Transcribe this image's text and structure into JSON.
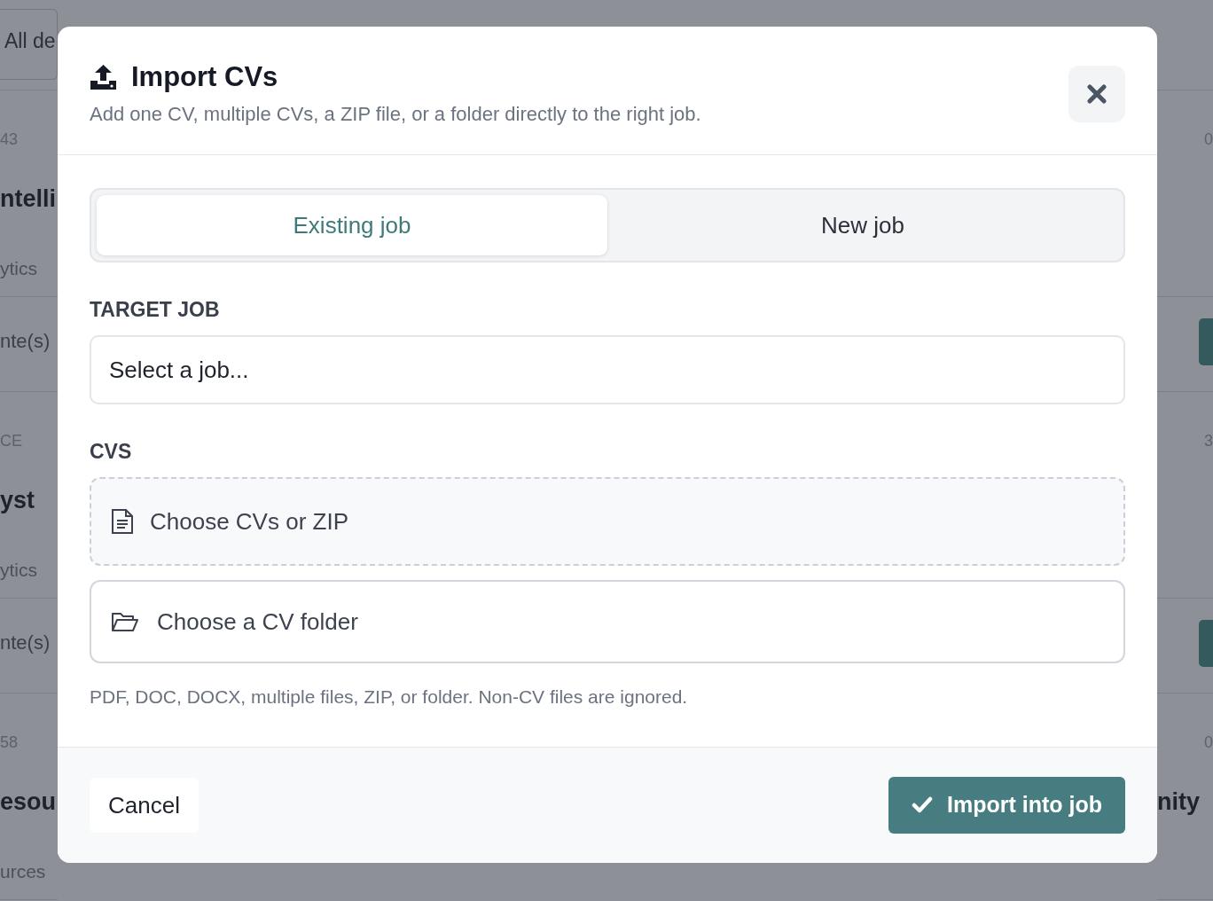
{
  "background": {
    "filter_field": {
      "value": "All de"
    },
    "left_cards": [
      {
        "label": "43",
        "title": "ntelli",
        "subtitle": "ytics",
        "meta": "nte(s)"
      },
      {
        "label": "CE",
        "title": "yst",
        "subtitle": "ytics",
        "meta": "nte(s)"
      },
      {
        "label": "58",
        "title": "esou",
        "subtitle": "urces"
      }
    ],
    "right_cards": [
      {
        "label": "0",
        "kind": "button"
      },
      {
        "label": "3",
        "kind": "button"
      },
      {
        "label": "0",
        "title": "nity"
      }
    ]
  },
  "dialog": {
    "title": "Import CVs",
    "subtitle": "Add one CV, multiple CVs, a ZIP file, or a folder directly to the right job.",
    "tabs": [
      {
        "label": "Existing job",
        "selected": true
      },
      {
        "label": "New job",
        "selected": false
      }
    ],
    "target_job": {
      "label": "TARGET JOB",
      "value": "Select a job..."
    },
    "cvs": {
      "label": "CVS",
      "choose_files": "Choose CVs or ZIP",
      "choose_folder": "Choose a CV folder",
      "help": "PDF, DOC, DOCX, multiple files, ZIP, or folder. Non-CV files are ignored."
    },
    "buttons": [
      {
        "label": "Cancel",
        "kind": "secondary"
      },
      {
        "label": "Import into job",
        "kind": "primary"
      }
    ]
  }
}
